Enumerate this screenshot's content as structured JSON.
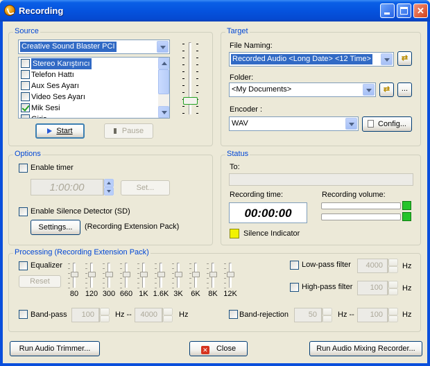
{
  "window": {
    "title": "Recording",
    "icon": "record-app-icon"
  },
  "source": {
    "group_title": "Source",
    "device": "Creative Sound Blaster PCI",
    "inputs": [
      {
        "label": "Stereo Karıştırıcı",
        "checked": false,
        "selected": true
      },
      {
        "label": "Telefon Hattı",
        "checked": false,
        "selected": false
      },
      {
        "label": "Aux Ses Ayarı",
        "checked": false,
        "selected": false
      },
      {
        "label": "Video Ses Ayarı",
        "checked": false,
        "selected": false
      },
      {
        "label": "Mik Sesi",
        "checked": true,
        "selected": false
      },
      {
        "label": "Giriş",
        "checked": false,
        "selected": false
      }
    ],
    "start_label": "Start",
    "pause_label": "Pause",
    "volume_level": 0.15
  },
  "target": {
    "group_title": "Target",
    "file_naming_label": "File Naming:",
    "file_naming_value": "Recorded Audio <Long Date> <12 Time>",
    "folder_label": "Folder:",
    "folder_value": "<My Documents>",
    "browse_label": "...",
    "encoder_label": "Encoder :",
    "encoder_value": "WAV",
    "config_label": "Config..."
  },
  "options": {
    "group_title": "Options",
    "enable_timer_label": "Enable timer",
    "timer_value": "1:00:00",
    "set_label": "Set...",
    "enable_sd_label": "Enable Silence Detector (SD)",
    "settings_label": "Settings...",
    "settings_note": "(Recording Extension Pack)"
  },
  "status": {
    "group_title": "Status",
    "to_label": "To:",
    "recording_time_label": "Recording time:",
    "recording_time_value": "00:00:00",
    "recording_volume_label": "Recording volume:",
    "silence_indicator_label": "Silence Indicator",
    "colors": {
      "led": "#26c42a",
      "silence": "#f2f200"
    }
  },
  "processing": {
    "group_title": "Processing (Recording Extension Pack)",
    "equalizer_label": "Equalizer",
    "reset_label": "Reset",
    "eq_bands": [
      "80",
      "120",
      "300",
      "660",
      "1K",
      "1.6K",
      "3K",
      "6K",
      "8K",
      "12K"
    ],
    "lowpass_label": "Low-pass filter",
    "lowpass_value": "4000",
    "highpass_label": "High-pass filter",
    "highpass_value": "100",
    "hz": "Hz",
    "hz_dash": "Hz --",
    "bandpass_label": "Band-pass",
    "bandpass_low": "100",
    "bandpass_high": "4000",
    "bandrejection_label": "Band-rejection",
    "bandrejection_low": "50",
    "bandrejection_high": "100"
  },
  "footer": {
    "trimmer_label": "Run Audio Trimmer...",
    "close_label": "Close",
    "mixing_label": "Run Audio Mixing Recorder..."
  }
}
